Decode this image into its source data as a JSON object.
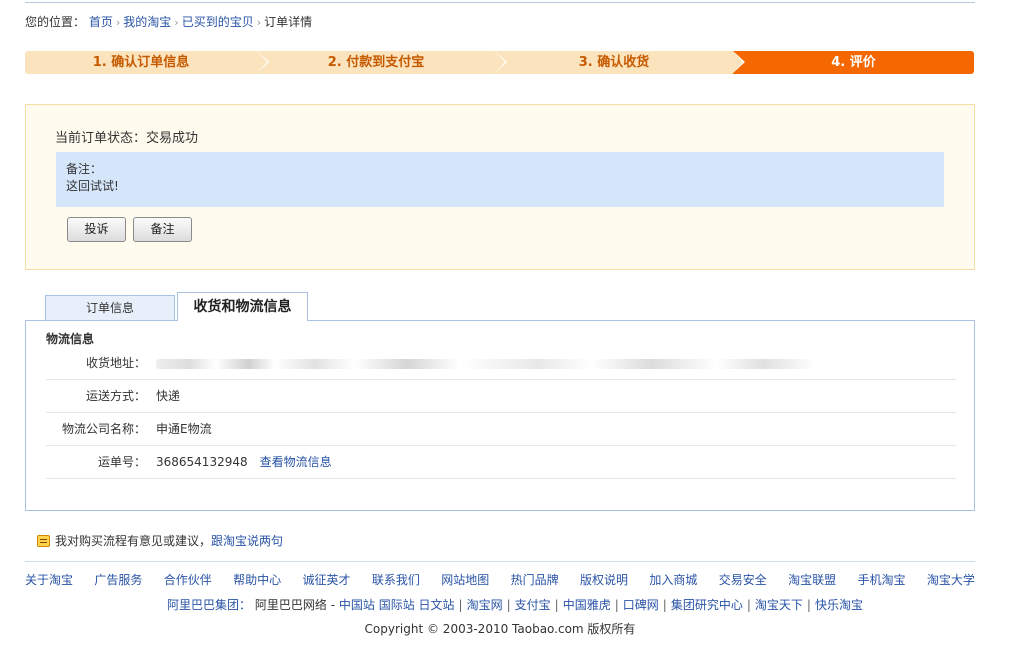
{
  "breadcrumb": {
    "prefix": "您的位置：",
    "items": [
      "首页",
      "我的淘宝",
      "已买到的宝贝"
    ],
    "current": "订单详情"
  },
  "steps": [
    {
      "label": "1. 确认订单信息",
      "active": false
    },
    {
      "label": "2. 付款到支付宝",
      "active": false
    },
    {
      "label": "3. 确认收货",
      "active": false
    },
    {
      "label": "4. 评价",
      "active": true
    }
  ],
  "status": {
    "label": "当前订单状态：",
    "value": "交易成功",
    "remark_label": "备注：",
    "remark_text": "这回试试!",
    "complain_button": "投诉",
    "remark_button": "备注"
  },
  "tabs": [
    {
      "label": "订单信息",
      "active": false
    },
    {
      "label": "收货和物流信息",
      "active": true
    }
  ],
  "logistics": {
    "title": "物流信息",
    "address_label": "收货地址：",
    "shipping_label": "运送方式：",
    "shipping_value": "快递",
    "company_label": "物流公司名称：",
    "company_value": "申通E物流",
    "tracking_label": "运单号：",
    "tracking_value": "368654132948",
    "tracking_link": "查看物流信息"
  },
  "feedback": {
    "text": "我对购买流程有意见或建议，",
    "link": "跟淘宝说两句",
    "icon": "feedback-icon"
  },
  "footer": {
    "links": [
      "关于淘宝",
      "广告服务",
      "合作伙伴",
      "帮助中心",
      "诚征英才",
      "联系我们",
      "网站地图",
      "热门品牌",
      "版权说明",
      "加入商城",
      "交易安全",
      "淘宝联盟",
      "手机淘宝",
      "淘宝大学"
    ],
    "group_label": "阿里巴巴集团：",
    "group_net": "阿里巴巴网络",
    "group_dash": " - ",
    "group_items": [
      "中国站",
      "国际站",
      "日文站",
      "淘宝网",
      "支付宝",
      "中国雅虎",
      "口碑网",
      "集团研究中心",
      "淘宝天下",
      "快乐淘宝"
    ],
    "copyright": "Copyright © 2003-2010 Taobao.com 版权所有"
  },
  "colors": {
    "step_active": "#f56700",
    "step_inactive": "#fbe3bd",
    "step_text": "#c65a00",
    "link": "#2953a6",
    "remark_bg": "#d5e6fb",
    "status_bg": "#fffbee"
  }
}
